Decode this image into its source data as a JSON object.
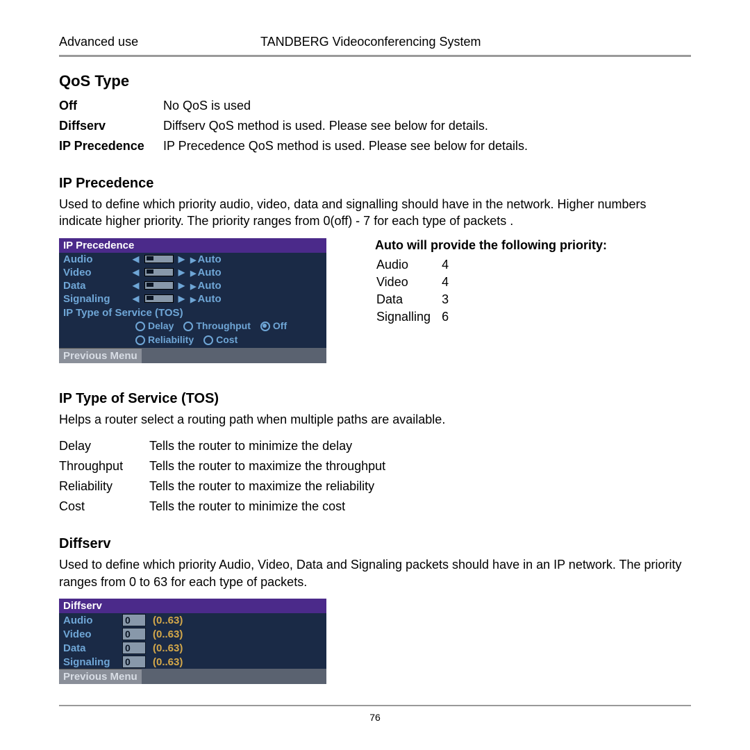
{
  "header": {
    "left": "Advanced use",
    "center": "TANDBERG Videoconferencing System"
  },
  "qos": {
    "heading": "QoS Type",
    "rows": [
      {
        "term": "Off",
        "desc": "No QoS is used"
      },
      {
        "term": "Diffserv",
        "desc": "Diffserv QoS method is used. Please see below for details."
      },
      {
        "term": "IP Precedence",
        "desc": "IP Precedence QoS method is used. Please see below for details."
      }
    ]
  },
  "ipprec": {
    "heading": "IP Precedence",
    "body": "Used to define which priority audio, video, data and signalling should have in the network. Higher numbers indicate higher priority. The priority ranges from 0(off) - 7 for each type of packets .",
    "panel": {
      "title": "IP Precedence",
      "rows": [
        {
          "label": "Audio",
          "value": "Auto"
        },
        {
          "label": "Video",
          "value": "Auto"
        },
        {
          "label": "Data",
          "value": "Auto"
        },
        {
          "label": "Signaling",
          "value": "Auto"
        }
      ],
      "tos_label": "IP Type of Service (TOS)",
      "radios": [
        "Delay",
        "Throughput",
        "Off",
        "Reliability",
        "Cost"
      ],
      "selected_radio": "Off",
      "footer": "Previous Menu"
    },
    "auto": {
      "heading": "Auto will provide the following priority:",
      "rows": [
        {
          "label": "Audio",
          "value": "4"
        },
        {
          "label": "Video",
          "value": "4"
        },
        {
          "label": "Data",
          "value": "3"
        },
        {
          "label": "Signalling",
          "value": "6"
        }
      ]
    }
  },
  "tos": {
    "heading": "IP Type of Service (TOS)",
    "body": "Helps a router select a routing path when multiple paths are available.",
    "rows": [
      {
        "term": "Delay",
        "desc": "Tells the router to minimize the delay"
      },
      {
        "term": "Throughput",
        "desc": "Tells the router to maximize the throughput"
      },
      {
        "term": "Reliability",
        "desc": "Tells the router to maximize the reliability"
      },
      {
        "term": "Cost",
        "desc": "Tells the router to minimize the cost"
      }
    ]
  },
  "diffserv": {
    "heading": "Diffserv",
    "body": "Used to define which priority Audio, Video, Data and Signaling packets should have in an IP network. The priority ranges from 0 to 63 for each type of packets.",
    "panel": {
      "title": "Diffserv",
      "rows": [
        {
          "label": "Audio",
          "value": "0",
          "range": "(0..63)"
        },
        {
          "label": "Video",
          "value": "0",
          "range": "(0..63)"
        },
        {
          "label": "Data",
          "value": "0",
          "range": "(0..63)"
        },
        {
          "label": "Signaling",
          "value": "0",
          "range": "(0..63)"
        }
      ],
      "footer": "Previous Menu"
    }
  },
  "page_number": "76"
}
